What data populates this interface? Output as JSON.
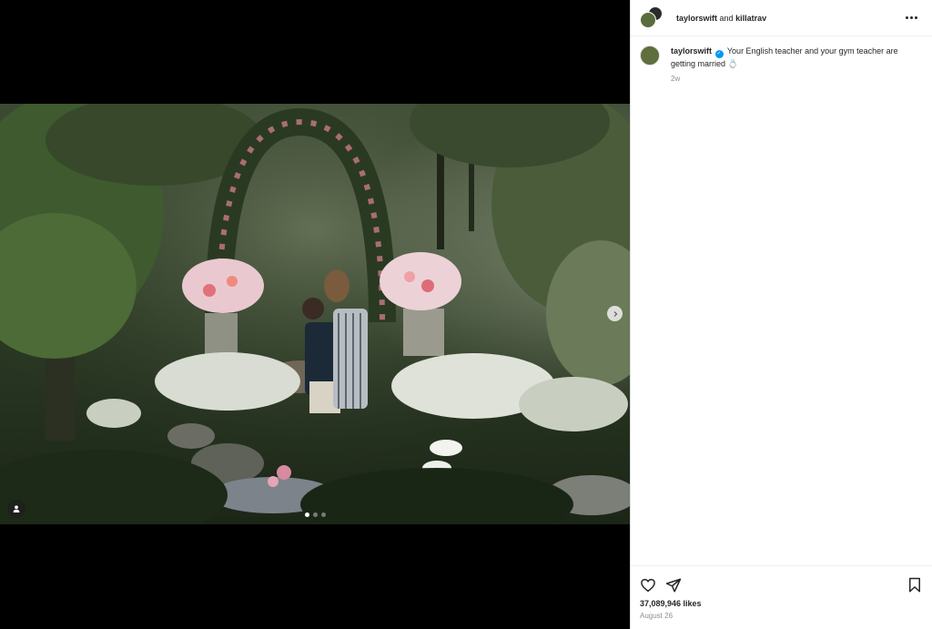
{
  "post": {
    "header": {
      "author": "taylorswift",
      "joiner": "and",
      "collaborator": "killatrav",
      "more_icon": "more-horizontal-icon"
    },
    "caption": {
      "username": "taylorswift",
      "verified": true,
      "text": "Your English teacher and your gym teacher are getting married",
      "emoji": "💍",
      "time": "2w"
    },
    "likes": "37,089,946 likes",
    "date": "August 26",
    "actions": [
      "heart-icon",
      "share-icon",
      "bookmark-icon"
    ]
  },
  "media": {
    "next_icon": "chevron-right-icon",
    "tag_icon": "user-tag-icon",
    "carousel_count": 3,
    "carousel_active": 1
  },
  "colors": {
    "verified": "#0095f6",
    "text": "#262626",
    "muted": "#8e8e8e",
    "border": "#efefef"
  }
}
